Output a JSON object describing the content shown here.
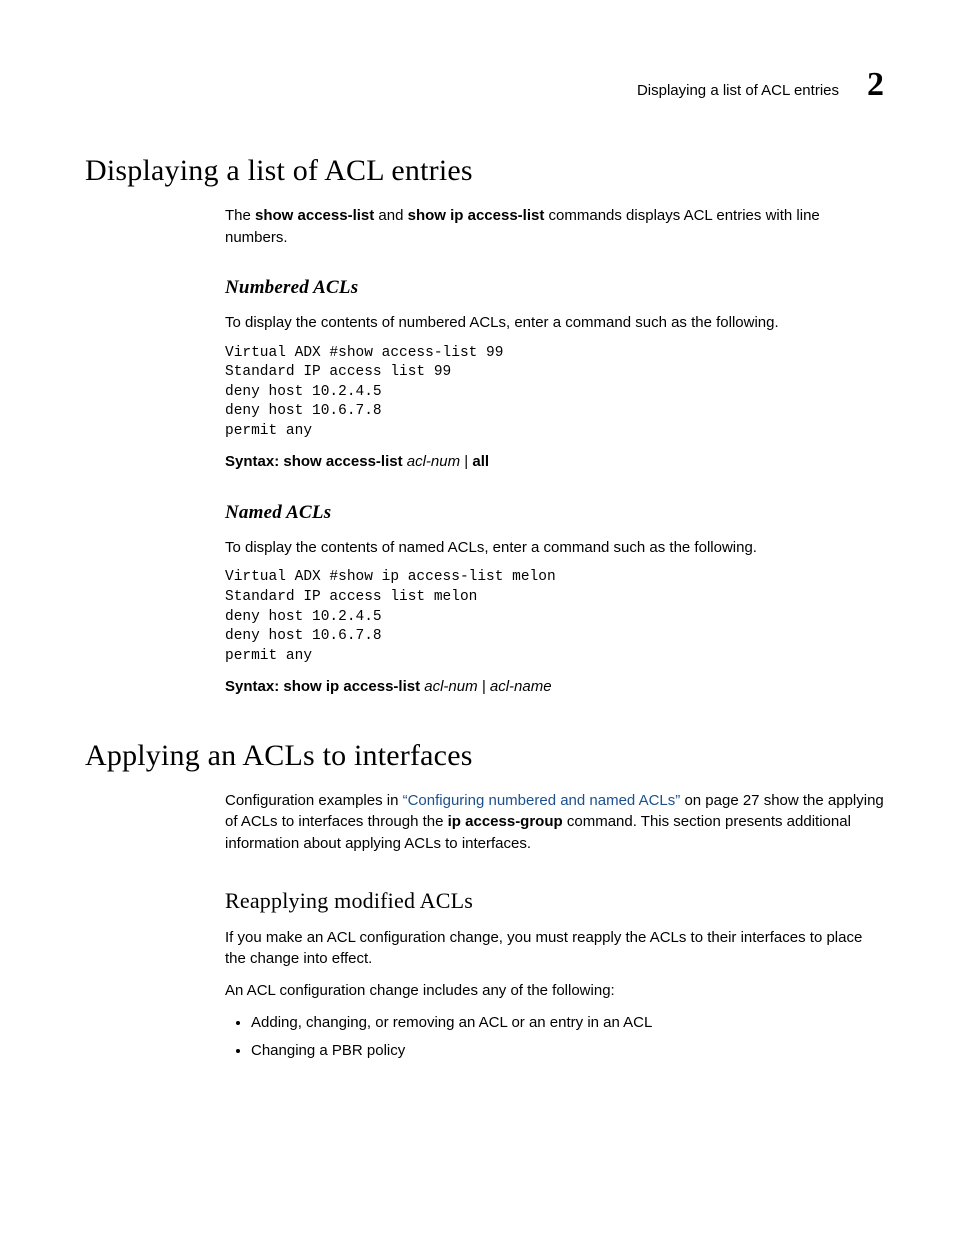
{
  "runhead": {
    "title": "Displaying a list of ACL entries",
    "chapter_number": "2"
  },
  "section1": {
    "heading": "Displaying a list of ACL entries",
    "intro": {
      "pre": "The ",
      "cmd1": "show access-list",
      "mid": " and ",
      "cmd2": "show ip access-list",
      "post": " commands displays ACL entries with line numbers."
    },
    "sub1": {
      "heading": "Numbered ACLs",
      "intro": "To display the contents of numbered ACLs, enter a command such as the following.",
      "code": "Virtual ADX #show access-list 99\nStandard IP access list 99\ndeny host 10.2.4.5\ndeny host 10.6.7.8\npermit any",
      "syntax": {
        "label": "Syntax:  ",
        "cmd": "show access-list",
        "arg": " acl-num",
        "sep": " | ",
        "all": "all"
      }
    },
    "sub2": {
      "heading": "Named ACLs",
      "intro": "To display the contents of named ACLs, enter a command such as the following.",
      "code": "Virtual ADX #show ip access-list melon\nStandard IP access list melon\ndeny host 10.2.4.5\ndeny host 10.6.7.8\npermit any",
      "syntax": {
        "label": "Syntax:  ",
        "cmd": "show ip access-list",
        "arg1": " acl-num",
        "sep": " | ",
        "arg2": "acl-name"
      }
    }
  },
  "section2": {
    "heading": "Applying an ACLs to interfaces",
    "intro": {
      "pre": "Configuration examples in ",
      "link": "“Configuring numbered and named ACLs”",
      "post1": " on page 27 show the applying of ACLs to interfaces through the ",
      "cmd": "ip access-group",
      "post2": " command. This section presents additional information about applying ACLs to interfaces."
    },
    "sub1": {
      "heading": "Reapplying modified ACLs",
      "p1": "If you make an ACL configuration change, you must reapply the ACLs to their interfaces to place the change into effect.",
      "p2": "An ACL configuration change includes any of the following:",
      "bullets": [
        "Adding, changing, or removing an ACL or an entry in an ACL",
        "Changing a PBR policy"
      ]
    }
  }
}
